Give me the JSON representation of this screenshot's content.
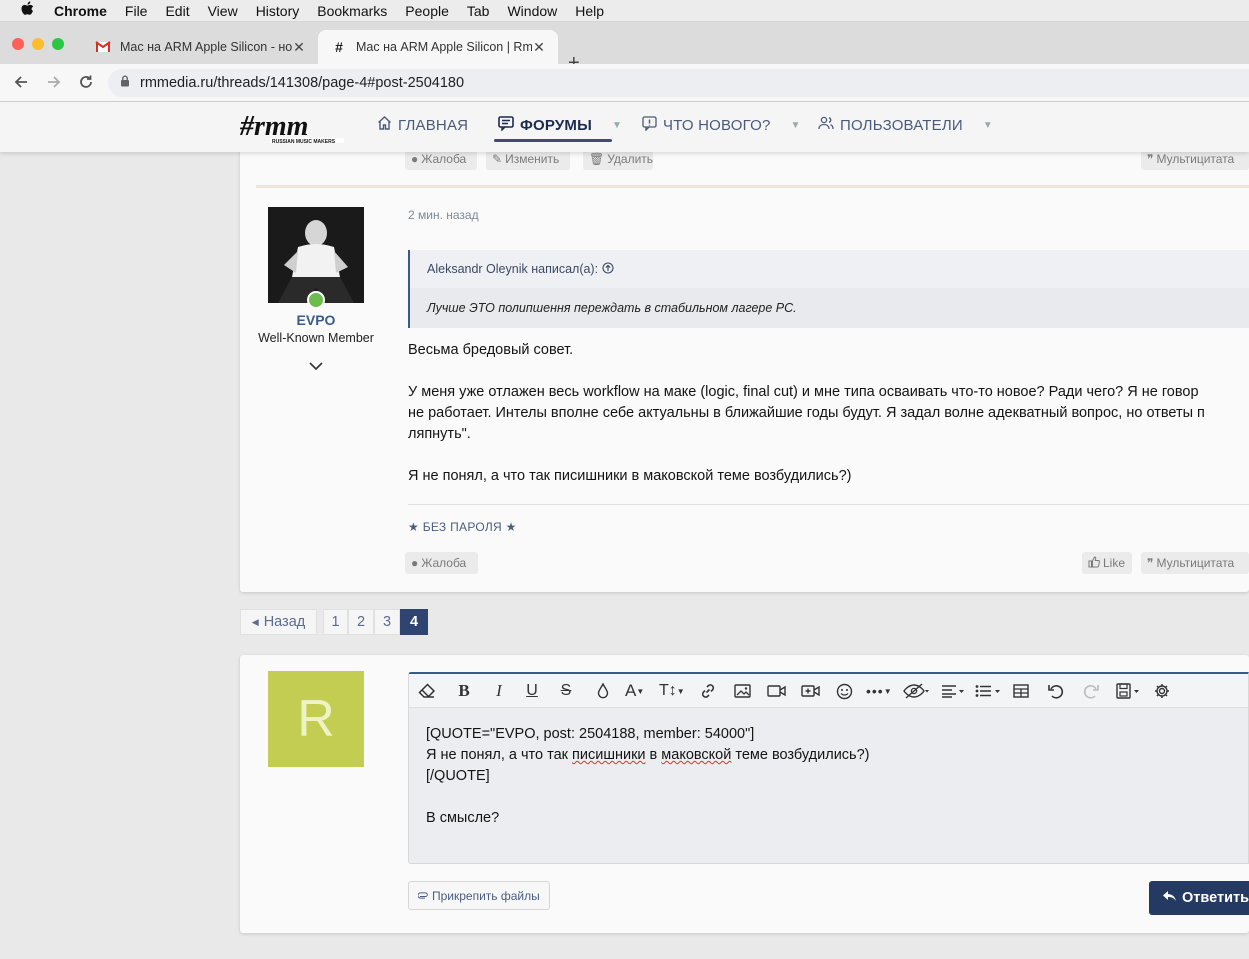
{
  "menubar": {
    "app": "Chrome",
    "items": [
      "File",
      "Edit",
      "View",
      "History",
      "Bookmarks",
      "People",
      "Tab",
      "Window",
      "Help"
    ]
  },
  "tabs": [
    {
      "title": "Mac на ARM Apple Silicon - но",
      "icon": "gmail-icon"
    },
    {
      "title": "Mac на ARM Apple Silicon | Rm",
      "icon": "rmm-icon"
    }
  ],
  "address": {
    "url": "rmmedia.ru/threads/141308/page-4#post-2504180"
  },
  "site_nav": {
    "home": "ГЛАВНАЯ",
    "forums": "ФОРУМЫ",
    "whats_new": "ЧТО НОВОГО?",
    "members": "ПОЛЬЗОВАТЕЛИ"
  },
  "prev_post_actions": {
    "report": "Жалоба",
    "edit": "Изменить",
    "delete": "Удалить",
    "multiquote": "Мультицитата"
  },
  "post": {
    "username": "EVPO",
    "user_title": "Well-Known Member",
    "time": "2 мин. назад",
    "quote_author": "Aleksandr Oleynik написал(а):",
    "quote_text": "Лучше ЭТО полипшення переждать в стабильном лагере PC.",
    "paragraphs": [
      "Весьма бредовый совет.",
      "У меня уже отлажен весь workflow на маке (logic, final cut) и мне типа осваивать что-то новое? Ради чего? Я не говор",
      "не работает. Интелы вполне себе актуальны в ближайшие годы будут. Я задал волне адекватный вопрос, но ответы п",
      "ляпнуть\".",
      "Я не понял, а что так писишники в маковской теме возбудились?)"
    ],
    "signature": "★ БЕЗ ПАРОЛЯ ★",
    "report": "Жалоба",
    "like": "Like",
    "multiquote": "Мультицитата"
  },
  "pagination": {
    "prev": "Назад",
    "pages": [
      "1",
      "2",
      "3",
      "4"
    ],
    "current": "4"
  },
  "reply": {
    "avatar_letter": "R",
    "avatar_color": "#c3cd52",
    "lines": {
      "l1": "[QUOTE=\"EVPO, post: 2504188, member: 54000\"]",
      "l2a": "Я не понял, а что так ",
      "l2b": "писишники",
      "l2c": " в ",
      "l2d": "маковской",
      "l2e": " теме возбудились?)",
      "l3": "[/QUOTE]",
      "l4": "В смысле?"
    },
    "attach_label": "Прикрепить файлы",
    "submit_label": "Ответить"
  },
  "colors": {
    "accent": "#3a5a8c",
    "submit": "#253a63",
    "online": "#6cbd4d"
  }
}
